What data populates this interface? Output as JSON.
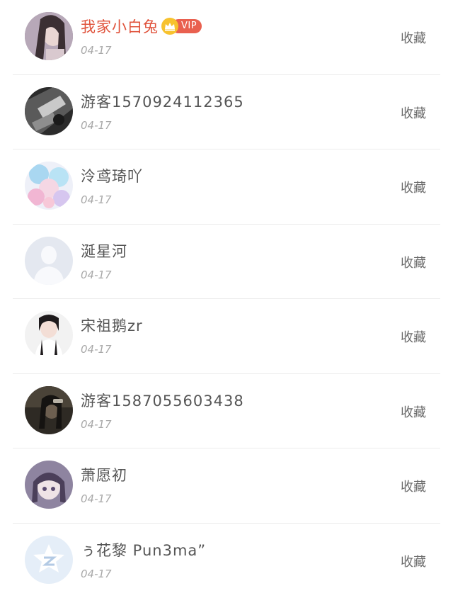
{
  "users": [
    {
      "name": "我家小白兔",
      "vip": true,
      "vip_label": "VIP",
      "date": "04-17",
      "action": "收藏",
      "avatar": "girl-long-hair-avatar"
    },
    {
      "name": "游客1570924112365",
      "vip": false,
      "date": "04-17",
      "action": "收藏",
      "avatar": "dark-monochrome-avatar"
    },
    {
      "name": "泠鸢琦吖",
      "vip": false,
      "date": "04-17",
      "action": "收藏",
      "avatar": "anime-pastel-avatar"
    },
    {
      "name": "涎星河",
      "vip": false,
      "date": "04-17",
      "action": "收藏",
      "avatar": "default-person-avatar"
    },
    {
      "name": "宋祖鹅zr",
      "vip": false,
      "date": "04-17",
      "action": "收藏",
      "avatar": "girl-portrait-avatar"
    },
    {
      "name": "游客1587055603438",
      "vip": false,
      "date": "04-17",
      "action": "收藏",
      "avatar": "dark-photo-avatar"
    },
    {
      "name": "萧愿初",
      "vip": false,
      "date": "04-17",
      "action": "收藏",
      "avatar": "anime-girl-avatar"
    },
    {
      "name": "ぅ花黎 Pun3ma”",
      "vip": false,
      "date": "04-17",
      "action": "收藏",
      "avatar": "star-logo-avatar"
    }
  ],
  "colors": {
    "vip_name": "#e0533c",
    "vip_badge": "#e9604f",
    "crown": "#f7c22e",
    "name": "#555555",
    "date": "#a8a8a8",
    "action": "#6a6a6a",
    "divider": "#ececec"
  }
}
